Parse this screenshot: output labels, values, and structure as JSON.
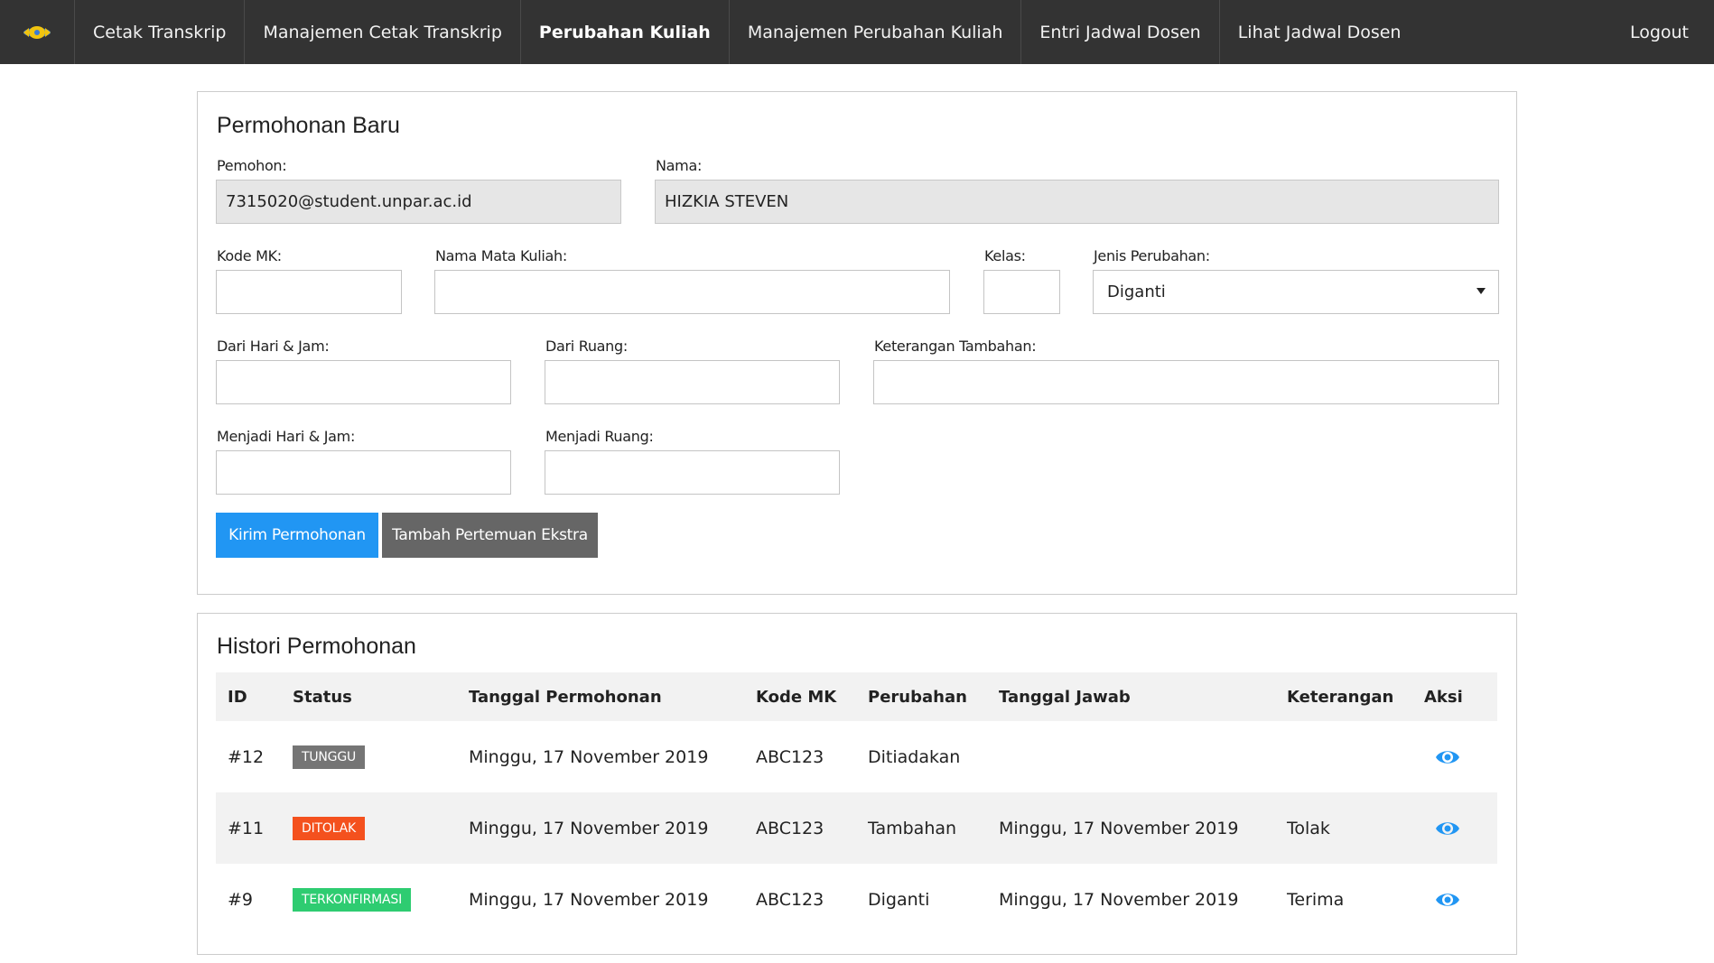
{
  "navbar": {
    "logo_icon": "university-logo-icon",
    "items": [
      {
        "label": "Cetak Transkrip",
        "active": false
      },
      {
        "label": "Manajemen Cetak Transkrip",
        "active": false
      },
      {
        "label": "Perubahan Kuliah",
        "active": true
      },
      {
        "label": "Manajemen Perubahan Kuliah",
        "active": false
      },
      {
        "label": "Entri Jadwal Dosen",
        "active": false
      },
      {
        "label": "Lihat Jadwal Dosen",
        "active": false
      }
    ],
    "logout_label": "Logout"
  },
  "form": {
    "title": "Permohonan Baru",
    "pemohon_label": "Pemohon:",
    "pemohon_value": "7315020@student.unpar.ac.id",
    "nama_label": "Nama:",
    "nama_value": "HIZKIA STEVEN",
    "kode_mk_label": "Kode MK:",
    "nama_mk_label": "Nama Mata Kuliah:",
    "kelas_label": "Kelas:",
    "jenis_label": "Jenis Perubahan:",
    "jenis_value": "Diganti",
    "dari_hari_label": "Dari Hari & Jam:",
    "dari_ruang_label": "Dari Ruang:",
    "keterangan_label": "Keterangan Tambahan:",
    "menjadi_hari_label": "Menjadi Hari & Jam:",
    "menjadi_ruang_label": "Menjadi Ruang:",
    "submit_label": "Kirim Permohonan",
    "extra_label": "Tambah Pertemuan Ekstra"
  },
  "history": {
    "title": "Histori Permohonan",
    "columns": [
      "ID",
      "Status",
      "Tanggal Permohonan",
      "Kode MK",
      "Perubahan",
      "Tanggal Jawab",
      "Keterangan",
      "Aksi"
    ],
    "rows": [
      {
        "id": "#12",
        "status": "TUNGGU",
        "status_color": "#757575",
        "tanggal": "Minggu, 17 November 2019",
        "kode": "ABC123",
        "perubahan": "Ditiadakan",
        "tanggal_jawab": "",
        "keterangan": ""
      },
      {
        "id": "#11",
        "status": "DITOLAK",
        "status_color": "#f4511e",
        "tanggal": "Minggu, 17 November 2019",
        "kode": "ABC123",
        "perubahan": "Tambahan",
        "tanggal_jawab": "Minggu, 17 November 2019",
        "keterangan": "Tolak"
      },
      {
        "id": "#9",
        "status": "TERKONFIRMASI",
        "status_color": "#2ecc71",
        "tanggal": "Minggu, 17 November 2019",
        "kode": "ABC123",
        "perubahan": "Diganti",
        "tanggal_jawab": "Minggu, 17 November 2019",
        "keterangan": "Terima"
      }
    ],
    "action_icon": "eye-icon",
    "action_color": "#2196f3"
  }
}
